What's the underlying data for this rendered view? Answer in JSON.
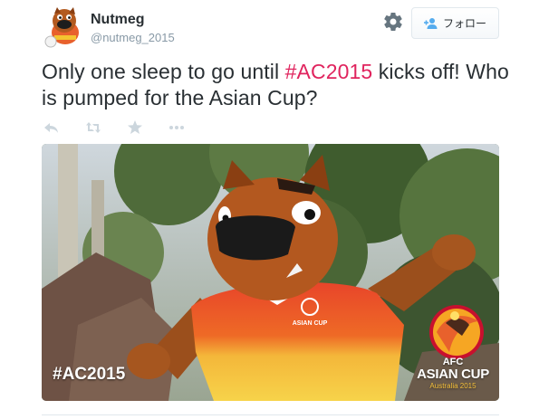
{
  "user": {
    "name": "Nutmeg",
    "handle": "@nutmeg_2015"
  },
  "follow_button": {
    "label": "フォロー",
    "icon": "add-user-icon"
  },
  "settings_icon": "gear-icon",
  "tweet": {
    "text_before": "Only one sleep to go until ",
    "hashtag": "#AC2015",
    "text_after": " kicks off! Who is pumped for the Asian Cup?"
  },
  "actions": [
    {
      "name": "reply-icon"
    },
    {
      "name": "retweet-icon"
    },
    {
      "name": "favorite-icon"
    },
    {
      "name": "more-icon"
    }
  ],
  "media": {
    "hashtag_overlay": "#AC2015",
    "logo": {
      "afc": "AFC",
      "title": "ASIAN CUP",
      "subtitle": "Australia 2015"
    }
  },
  "colors": {
    "hashtag": "#e0245e",
    "text": "#292f33",
    "muted": "#8899a6",
    "action_icons": "#ccd6dd"
  }
}
